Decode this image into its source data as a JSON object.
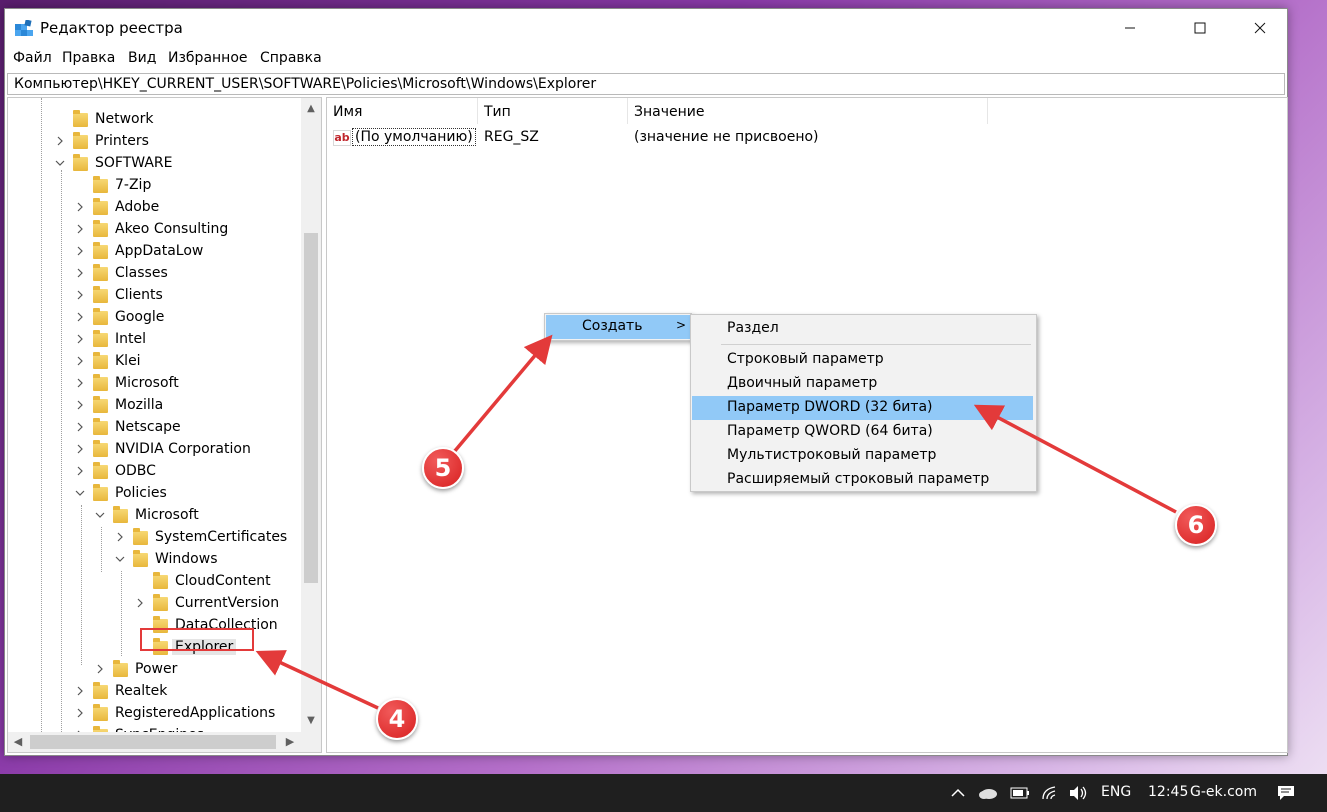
{
  "window": {
    "title": "Редактор реестра"
  },
  "menu": [
    "Файл",
    "Правка",
    "Вид",
    "Избранное",
    "Справка"
  ],
  "address": "Компьютер\\HKEY_CURRENT_USER\\SOFTWARE\\Policies\\Microsoft\\Windows\\Explorer",
  "tree": [
    {
      "label": "Network",
      "level": 0,
      "chev": ""
    },
    {
      "label": "Printers",
      "level": 0,
      "chev": ">"
    },
    {
      "label": "SOFTWARE",
      "level": 0,
      "chev": "v"
    },
    {
      "label": "7-Zip",
      "level": 1,
      "chev": ""
    },
    {
      "label": "Adobe",
      "level": 1,
      "chev": ">"
    },
    {
      "label": "Akeo Consulting",
      "level": 1,
      "chev": ">"
    },
    {
      "label": "AppDataLow",
      "level": 1,
      "chev": ">"
    },
    {
      "label": "Classes",
      "level": 1,
      "chev": ">"
    },
    {
      "label": "Clients",
      "level": 1,
      "chev": ">"
    },
    {
      "label": "Google",
      "level": 1,
      "chev": ">"
    },
    {
      "label": "Intel",
      "level": 1,
      "chev": ">"
    },
    {
      "label": "Klei",
      "level": 1,
      "chev": ">"
    },
    {
      "label": "Microsoft",
      "level": 1,
      "chev": ">"
    },
    {
      "label": "Mozilla",
      "level": 1,
      "chev": ">"
    },
    {
      "label": "Netscape",
      "level": 1,
      "chev": ">"
    },
    {
      "label": "NVIDIA Corporation",
      "level": 1,
      "chev": ">"
    },
    {
      "label": "ODBC",
      "level": 1,
      "chev": ">"
    },
    {
      "label": "Policies",
      "level": 1,
      "chev": "v"
    },
    {
      "label": "Microsoft",
      "level": 2,
      "chev": "v"
    },
    {
      "label": "SystemCertificates",
      "level": 3,
      "chev": ">"
    },
    {
      "label": "Windows",
      "level": 3,
      "chev": "v"
    },
    {
      "label": "CloudContent",
      "level": 4,
      "chev": ""
    },
    {
      "label": "CurrentVersion",
      "level": 4,
      "chev": ">"
    },
    {
      "label": "DataCollection",
      "level": 4,
      "chev": ""
    },
    {
      "label": "Explorer",
      "level": 4,
      "chev": "",
      "selected": true
    },
    {
      "label": "Power",
      "level": 2,
      "chev": ">"
    },
    {
      "label": "Realtek",
      "level": 1,
      "chev": ">"
    },
    {
      "label": "RegisteredApplications",
      "level": 1,
      "chev": ">"
    },
    {
      "label": "SyncEngines",
      "level": 1,
      "chev": ">"
    }
  ],
  "columns": {
    "name": "Имя",
    "type": "Тип",
    "value": "Значение"
  },
  "rows": [
    {
      "name": "(По умолчанию)",
      "type": "REG_SZ",
      "value": "(значение не присвоено)"
    }
  ],
  "context_menu": {
    "item": "Создать",
    "arrow": ">"
  },
  "submenu": {
    "items": [
      "Раздел",
      "Строковый параметр",
      "Двоичный параметр",
      "Параметр DWORD (32 бита)",
      "Параметр QWORD (64 бита)",
      "Мультистроковый параметр",
      "Расширяемый строковый параметр"
    ],
    "highlighted": 3
  },
  "annotations": [
    "4",
    "5",
    "6"
  ],
  "taskbar": {
    "lang": "ENG",
    "time": "12:45",
    "site": "G-ek.com"
  },
  "colors": {
    "annotation": "#e33a3a",
    "highlight": "#91c9f7",
    "taskbar": "#1f1f1f"
  }
}
